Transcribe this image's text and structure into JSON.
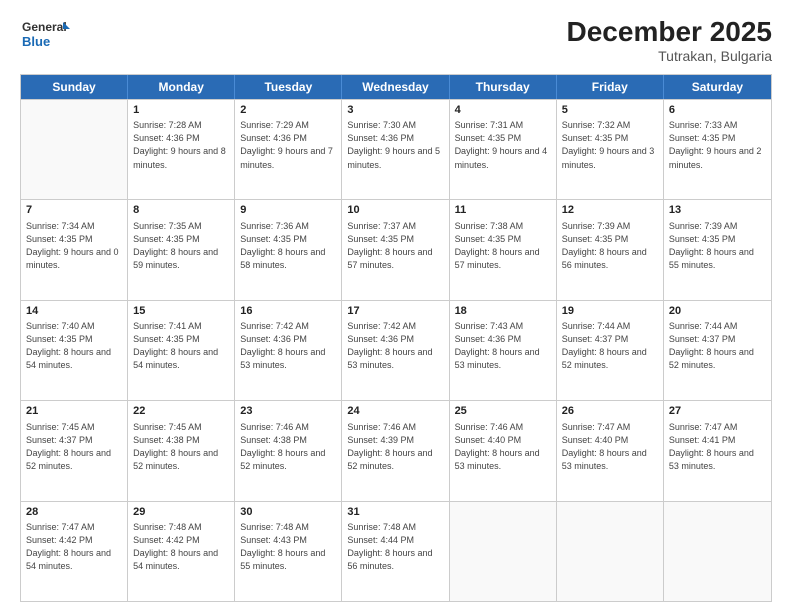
{
  "logo": {
    "line1": "General",
    "line2": "Blue"
  },
  "header": {
    "title": "December 2025",
    "subtitle": "Tutrakan, Bulgaria"
  },
  "weekdays": [
    "Sunday",
    "Monday",
    "Tuesday",
    "Wednesday",
    "Thursday",
    "Friday",
    "Saturday"
  ],
  "rows": [
    [
      {
        "day": "",
        "sunrise": "",
        "sunset": "",
        "daylight": ""
      },
      {
        "day": "1",
        "sunrise": "Sunrise: 7:28 AM",
        "sunset": "Sunset: 4:36 PM",
        "daylight": "Daylight: 9 hours and 8 minutes."
      },
      {
        "day": "2",
        "sunrise": "Sunrise: 7:29 AM",
        "sunset": "Sunset: 4:36 PM",
        "daylight": "Daylight: 9 hours and 7 minutes."
      },
      {
        "day": "3",
        "sunrise": "Sunrise: 7:30 AM",
        "sunset": "Sunset: 4:36 PM",
        "daylight": "Daylight: 9 hours and 5 minutes."
      },
      {
        "day": "4",
        "sunrise": "Sunrise: 7:31 AM",
        "sunset": "Sunset: 4:35 PM",
        "daylight": "Daylight: 9 hours and 4 minutes."
      },
      {
        "day": "5",
        "sunrise": "Sunrise: 7:32 AM",
        "sunset": "Sunset: 4:35 PM",
        "daylight": "Daylight: 9 hours and 3 minutes."
      },
      {
        "day": "6",
        "sunrise": "Sunrise: 7:33 AM",
        "sunset": "Sunset: 4:35 PM",
        "daylight": "Daylight: 9 hours and 2 minutes."
      }
    ],
    [
      {
        "day": "7",
        "sunrise": "Sunrise: 7:34 AM",
        "sunset": "Sunset: 4:35 PM",
        "daylight": "Daylight: 9 hours and 0 minutes."
      },
      {
        "day": "8",
        "sunrise": "Sunrise: 7:35 AM",
        "sunset": "Sunset: 4:35 PM",
        "daylight": "Daylight: 8 hours and 59 minutes."
      },
      {
        "day": "9",
        "sunrise": "Sunrise: 7:36 AM",
        "sunset": "Sunset: 4:35 PM",
        "daylight": "Daylight: 8 hours and 58 minutes."
      },
      {
        "day": "10",
        "sunrise": "Sunrise: 7:37 AM",
        "sunset": "Sunset: 4:35 PM",
        "daylight": "Daylight: 8 hours and 57 minutes."
      },
      {
        "day": "11",
        "sunrise": "Sunrise: 7:38 AM",
        "sunset": "Sunset: 4:35 PM",
        "daylight": "Daylight: 8 hours and 57 minutes."
      },
      {
        "day": "12",
        "sunrise": "Sunrise: 7:39 AM",
        "sunset": "Sunset: 4:35 PM",
        "daylight": "Daylight: 8 hours and 56 minutes."
      },
      {
        "day": "13",
        "sunrise": "Sunrise: 7:39 AM",
        "sunset": "Sunset: 4:35 PM",
        "daylight": "Daylight: 8 hours and 55 minutes."
      }
    ],
    [
      {
        "day": "14",
        "sunrise": "Sunrise: 7:40 AM",
        "sunset": "Sunset: 4:35 PM",
        "daylight": "Daylight: 8 hours and 54 minutes."
      },
      {
        "day": "15",
        "sunrise": "Sunrise: 7:41 AM",
        "sunset": "Sunset: 4:35 PM",
        "daylight": "Daylight: 8 hours and 54 minutes."
      },
      {
        "day": "16",
        "sunrise": "Sunrise: 7:42 AM",
        "sunset": "Sunset: 4:36 PM",
        "daylight": "Daylight: 8 hours and 53 minutes."
      },
      {
        "day": "17",
        "sunrise": "Sunrise: 7:42 AM",
        "sunset": "Sunset: 4:36 PM",
        "daylight": "Daylight: 8 hours and 53 minutes."
      },
      {
        "day": "18",
        "sunrise": "Sunrise: 7:43 AM",
        "sunset": "Sunset: 4:36 PM",
        "daylight": "Daylight: 8 hours and 53 minutes."
      },
      {
        "day": "19",
        "sunrise": "Sunrise: 7:44 AM",
        "sunset": "Sunset: 4:37 PM",
        "daylight": "Daylight: 8 hours and 52 minutes."
      },
      {
        "day": "20",
        "sunrise": "Sunrise: 7:44 AM",
        "sunset": "Sunset: 4:37 PM",
        "daylight": "Daylight: 8 hours and 52 minutes."
      }
    ],
    [
      {
        "day": "21",
        "sunrise": "Sunrise: 7:45 AM",
        "sunset": "Sunset: 4:37 PM",
        "daylight": "Daylight: 8 hours and 52 minutes."
      },
      {
        "day": "22",
        "sunrise": "Sunrise: 7:45 AM",
        "sunset": "Sunset: 4:38 PM",
        "daylight": "Daylight: 8 hours and 52 minutes."
      },
      {
        "day": "23",
        "sunrise": "Sunrise: 7:46 AM",
        "sunset": "Sunset: 4:38 PM",
        "daylight": "Daylight: 8 hours and 52 minutes."
      },
      {
        "day": "24",
        "sunrise": "Sunrise: 7:46 AM",
        "sunset": "Sunset: 4:39 PM",
        "daylight": "Daylight: 8 hours and 52 minutes."
      },
      {
        "day": "25",
        "sunrise": "Sunrise: 7:46 AM",
        "sunset": "Sunset: 4:40 PM",
        "daylight": "Daylight: 8 hours and 53 minutes."
      },
      {
        "day": "26",
        "sunrise": "Sunrise: 7:47 AM",
        "sunset": "Sunset: 4:40 PM",
        "daylight": "Daylight: 8 hours and 53 minutes."
      },
      {
        "day": "27",
        "sunrise": "Sunrise: 7:47 AM",
        "sunset": "Sunset: 4:41 PM",
        "daylight": "Daylight: 8 hours and 53 minutes."
      }
    ],
    [
      {
        "day": "28",
        "sunrise": "Sunrise: 7:47 AM",
        "sunset": "Sunset: 4:42 PM",
        "daylight": "Daylight: 8 hours and 54 minutes."
      },
      {
        "day": "29",
        "sunrise": "Sunrise: 7:48 AM",
        "sunset": "Sunset: 4:42 PM",
        "daylight": "Daylight: 8 hours and 54 minutes."
      },
      {
        "day": "30",
        "sunrise": "Sunrise: 7:48 AM",
        "sunset": "Sunset: 4:43 PM",
        "daylight": "Daylight: 8 hours and 55 minutes."
      },
      {
        "day": "31",
        "sunrise": "Sunrise: 7:48 AM",
        "sunset": "Sunset: 4:44 PM",
        "daylight": "Daylight: 8 hours and 56 minutes."
      },
      {
        "day": "",
        "sunrise": "",
        "sunset": "",
        "daylight": ""
      },
      {
        "day": "",
        "sunrise": "",
        "sunset": "",
        "daylight": ""
      },
      {
        "day": "",
        "sunrise": "",
        "sunset": "",
        "daylight": ""
      }
    ]
  ]
}
